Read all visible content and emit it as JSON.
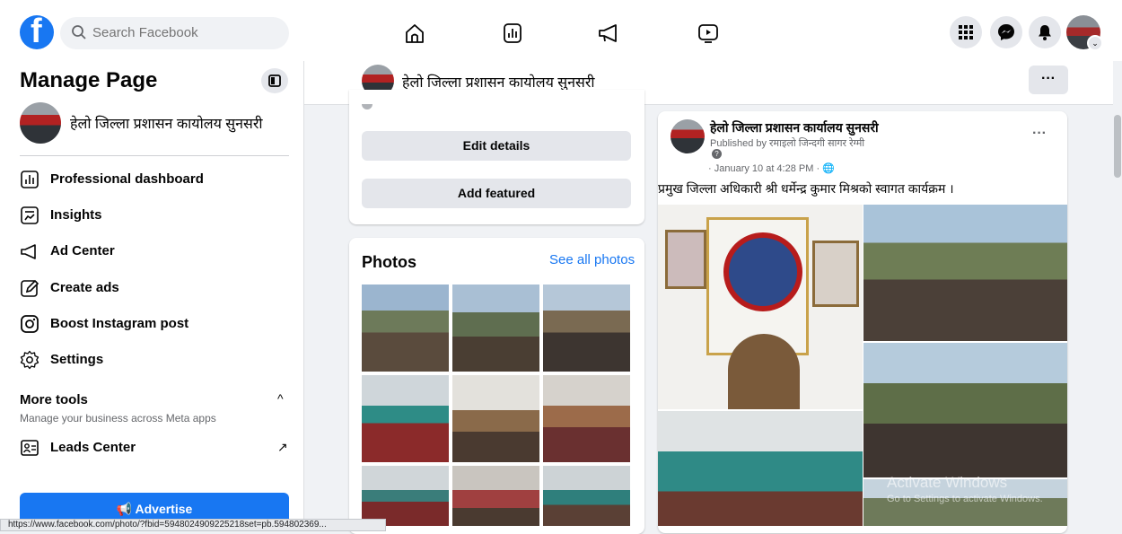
{
  "topbar": {
    "search_placeholder": "Search Facebook",
    "nav_icons": [
      "home-icon",
      "pages-icon",
      "ads-megaphone-icon",
      "watch-icon"
    ],
    "right_icons": [
      "menu-grid-icon",
      "messenger-icon",
      "notifications-bell-icon"
    ]
  },
  "sidebar": {
    "title": "Manage Page",
    "page_name": "हेलो जिल्ला प्रशासन कायोलय सुनसरी",
    "items": [
      {
        "label": "Professional dashboard",
        "icon": "dashboard-icon"
      },
      {
        "label": "Insights",
        "icon": "insights-icon"
      },
      {
        "label": "Ad Center",
        "icon": "megaphone-icon"
      },
      {
        "label": "Create ads",
        "icon": "pencil-icon"
      },
      {
        "label": "Boost Instagram post",
        "icon": "instagram-icon"
      },
      {
        "label": "Settings",
        "icon": "gear-icon"
      }
    ],
    "more_tools": {
      "title": "More tools",
      "subtitle": "Manage your business across Meta apps",
      "items": [
        {
          "label": "Leads Center",
          "icon": "leads-icon"
        }
      ]
    },
    "advertise_label": "Advertise"
  },
  "status_url": "https://www.facebook.com/photo/?fbid=5948024909225218set=pb.594802369...",
  "header": {
    "page_name": "हेलो जिल्ला प्रशासन कायोलय सुनसरी",
    "more_label": "···"
  },
  "intro": {
    "edit_details_label": "Edit details",
    "add_featured_label": "Add featured"
  },
  "photos": {
    "title": "Photos",
    "see_all_label": "See all photos"
  },
  "post": {
    "author": "हेलो जिल्ला प्रशासन कार्यालय सुनसरी",
    "published_by": "Published by रमाइलो जिन्दगी सागर रेग्मी",
    "date": "· January 10 at 4:28 PM ·",
    "text": "प्रमुख जिल्ला अधिकारी श्री धर्मेन्द्र कुमार मिश्रको स्वागत कार्यक्रम ।",
    "more_label": "···"
  },
  "watermark": {
    "title": "Activate Windows",
    "subtitle": "Go to Settings to activate Windows."
  },
  "colors": {
    "brand": "#1877f2",
    "bg": "#f0f2f5",
    "card": "#ffffff"
  }
}
